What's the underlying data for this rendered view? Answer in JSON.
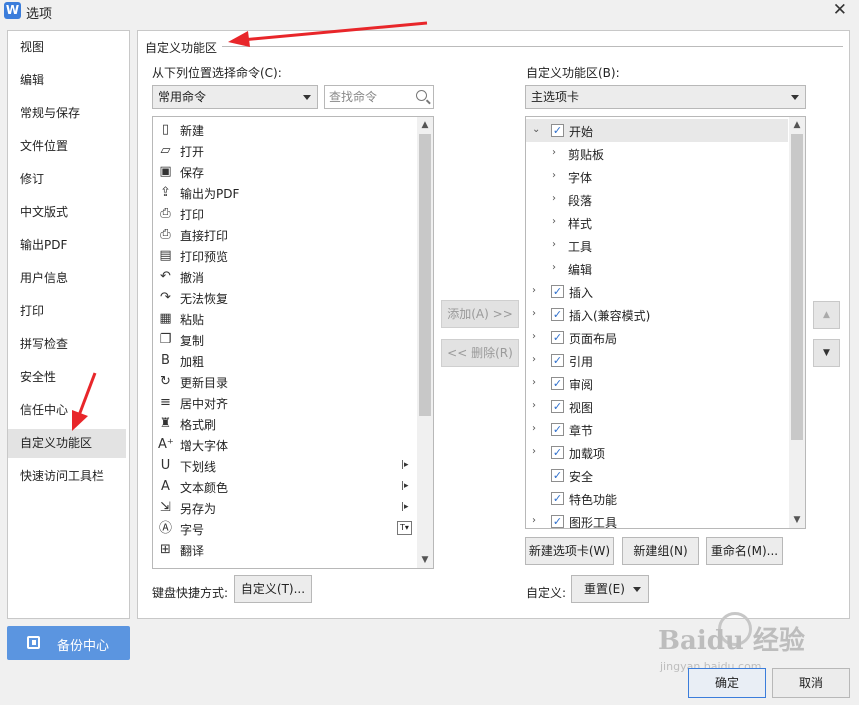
{
  "window": {
    "title": "选项",
    "app_icon_letter": "W"
  },
  "sidebar": {
    "items": [
      {
        "label": "视图"
      },
      {
        "label": "编辑"
      },
      {
        "label": "常规与保存"
      },
      {
        "label": "文件位置"
      },
      {
        "label": "修订"
      },
      {
        "label": "中文版式"
      },
      {
        "label": "输出PDF"
      },
      {
        "label": "用户信息"
      },
      {
        "label": "打印"
      },
      {
        "label": "拼写检查"
      },
      {
        "label": "安全性"
      },
      {
        "label": "信任中心"
      },
      {
        "label": "自定义功能区",
        "selected": true
      },
      {
        "label": "快速访问工具栏"
      }
    ],
    "backup_label": "备份中心"
  },
  "main": {
    "section_title": "自定义功能区",
    "left_label": "从下列位置选择命令(C):",
    "left_combo_value": "常用命令",
    "search_placeholder": "查找命令",
    "commands": [
      {
        "label": "新建",
        "icon": "new-doc-icon",
        "glyph": "▯"
      },
      {
        "label": "打开",
        "icon": "folder-open-icon",
        "glyph": "▱"
      },
      {
        "label": "保存",
        "icon": "save-icon",
        "glyph": "▣"
      },
      {
        "label": "输出为PDF",
        "icon": "export-pdf-icon",
        "glyph": "⇪"
      },
      {
        "label": "打印",
        "icon": "print-icon",
        "glyph": "⎙"
      },
      {
        "label": "直接打印",
        "icon": "direct-print-icon",
        "glyph": "⎙"
      },
      {
        "label": "打印预览",
        "icon": "print-preview-icon",
        "glyph": "▤"
      },
      {
        "label": "撤消",
        "icon": "undo-icon",
        "glyph": "↶"
      },
      {
        "label": "无法恢复",
        "icon": "redo-icon",
        "glyph": "↷"
      },
      {
        "label": "粘贴",
        "icon": "paste-icon",
        "glyph": "▦"
      },
      {
        "label": "复制",
        "icon": "copy-icon",
        "glyph": "❐"
      },
      {
        "label": "加粗",
        "icon": "bold-icon",
        "glyph": "B"
      },
      {
        "label": "更新目录",
        "icon": "update-toc-icon",
        "glyph": "↻"
      },
      {
        "label": "居中对齐",
        "icon": "align-center-icon",
        "glyph": "≡"
      },
      {
        "label": "格式刷",
        "icon": "format-painter-icon",
        "glyph": "♜"
      },
      {
        "label": "增大字体",
        "icon": "font-grow-icon",
        "glyph": "A⁺"
      },
      {
        "label": "下划线",
        "icon": "underline-icon",
        "glyph": "U",
        "submenu": true
      },
      {
        "label": "文本颜色",
        "icon": "text-color-icon",
        "glyph": "A",
        "submenu": true
      },
      {
        "label": "另存为",
        "icon": "save-as-icon",
        "glyph": "⇲",
        "submenu": true
      },
      {
        "label": "字号",
        "icon": "font-size-icon",
        "glyph": "Ⓐ",
        "dropdown": true
      },
      {
        "label": "翻译",
        "icon": "translate-icon",
        "glyph": "⊞"
      }
    ],
    "add_label": "添加(A) >>",
    "remove_label": "<< 删除(R)",
    "right_label": "自定义功能区(B):",
    "right_combo_value": "主选项卡",
    "tree": [
      {
        "label": "开始",
        "level": 0,
        "expanded": true,
        "checked": true,
        "highlight": true
      },
      {
        "label": "剪贴板",
        "level": 1
      },
      {
        "label": "字体",
        "level": 1
      },
      {
        "label": "段落",
        "level": 1
      },
      {
        "label": "样式",
        "level": 1
      },
      {
        "label": "工具",
        "level": 1
      },
      {
        "label": "编辑",
        "level": 1
      },
      {
        "label": "插入",
        "level": 0,
        "checked": true
      },
      {
        "label": "插入(兼容模式)",
        "level": 0,
        "checked": true
      },
      {
        "label": "页面布局",
        "level": 0,
        "checked": true
      },
      {
        "label": "引用",
        "level": 0,
        "checked": true
      },
      {
        "label": "审阅",
        "level": 0,
        "checked": true
      },
      {
        "label": "视图",
        "level": 0,
        "checked": true
      },
      {
        "label": "章节",
        "level": 0,
        "checked": true
      },
      {
        "label": "加载项",
        "level": 0,
        "checked": true
      },
      {
        "label": "安全",
        "level": 0,
        "checked": true,
        "no_expander": true
      },
      {
        "label": "特色功能",
        "level": 0,
        "checked": true,
        "no_expander": true
      },
      {
        "label": "图形工具",
        "level": 0,
        "checked": true
      }
    ],
    "new_tab_label": "新建选项卡(W)",
    "new_group_label": "新建组(N)",
    "rename_label": "重命名(M)...",
    "keyboard_label": "键盘快捷方式:",
    "keyboard_button": "自定义(T)...",
    "custom_label": "自定义:",
    "reset_label": "重置(E)"
  },
  "footer": {
    "ok_label": "确定",
    "cancel_label": "取消"
  },
  "watermark": {
    "main": "Baidu 经验",
    "sub": "jingyan.baidu.com"
  },
  "colors": {
    "accent": "#3b7ddb",
    "backup_button": "#5b95e0",
    "annotation_arrow": "#e8262a"
  }
}
